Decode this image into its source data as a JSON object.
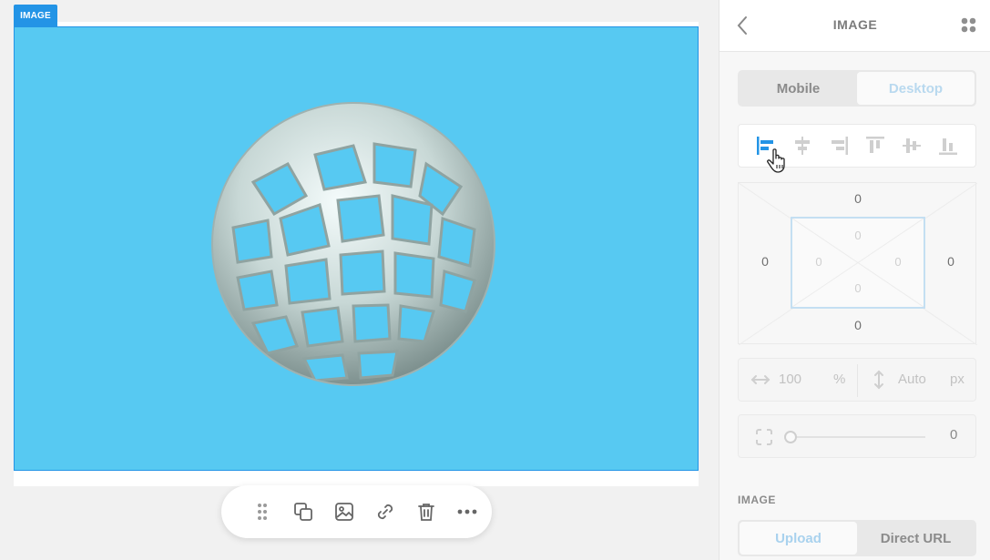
{
  "canvas": {
    "block_tag": "IMAGE",
    "image_bg_color": "#57c9f2",
    "accent_color": "#2394e6",
    "toolbar": {
      "icons": [
        "drag-handle-icon",
        "duplicate-icon",
        "image-icon",
        "link-icon",
        "trash-icon",
        "more-icon"
      ]
    }
  },
  "sidebar": {
    "title": "IMAGE",
    "back_icon": "chevron-left-icon",
    "grid_icon": "grid-dots-icon",
    "device_toggle": {
      "options": [
        {
          "label": "Mobile",
          "active": false
        },
        {
          "label": "Desktop",
          "active": true
        }
      ]
    },
    "alignment_icons": [
      "align-left-icon",
      "align-center-h-icon",
      "align-right-icon",
      "align-top-icon",
      "align-center-v-icon",
      "align-bottom-icon"
    ],
    "spacing": {
      "margin": {
        "top": "0",
        "right": "0",
        "bottom": "0",
        "left": "0"
      },
      "padding": {
        "top": "0",
        "right": "0",
        "bottom": "0",
        "left": "0"
      }
    },
    "size": {
      "width_value": "100",
      "width_unit": "%",
      "height_value": "Auto",
      "height_unit": "px"
    },
    "radius": {
      "value": "0",
      "slider_fraction": 0
    },
    "image_section": {
      "label": "IMAGE",
      "source_options": [
        {
          "label": "Upload",
          "active": true
        },
        {
          "label": "Direct URL",
          "active": false
        }
      ]
    }
  }
}
